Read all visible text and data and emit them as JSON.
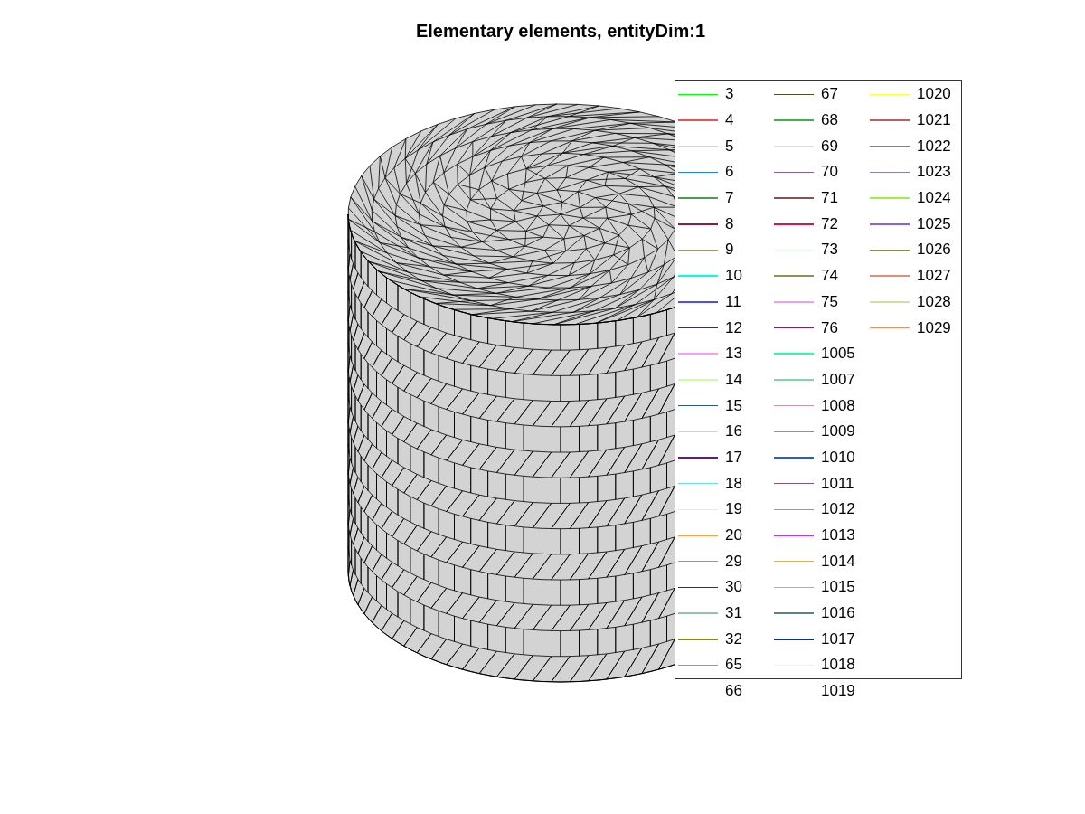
{
  "title": "Elementary elements, entityDim:1",
  "legend": {
    "entries": [
      {
        "label": "3",
        "color": "#00ff00"
      },
      {
        "label": "4",
        "color": "#f05050"
      },
      {
        "label": "5",
        "color": "#f5d76e"
      },
      {
        "label": "6",
        "color": "#1a80ff"
      },
      {
        "label": "7",
        "color": "#4d9e4d"
      },
      {
        "label": "8",
        "color": "#8b1a4a"
      },
      {
        "label": "9",
        "color": "#b89070"
      },
      {
        "label": "10",
        "color": "#00ffe0"
      },
      {
        "label": "11",
        "color": "#4d4dff"
      },
      {
        "label": "12",
        "color": "#3d2b5c"
      },
      {
        "label": "13",
        "color": "#ff99ff"
      },
      {
        "label": "14",
        "color": "#ccff99"
      },
      {
        "label": "15",
        "color": "#2b5c80"
      },
      {
        "label": "16",
        "color": "#ffc0c0"
      },
      {
        "label": "17",
        "color": "#6a0dad"
      },
      {
        "label": "18",
        "color": "#66e0f0"
      },
      {
        "label": "19",
        "color": "#ffe8b0"
      },
      {
        "label": "20",
        "color": "#ffa040"
      },
      {
        "label": "29",
        "color": "#b09090"
      },
      {
        "label": "30",
        "color": "#8b0a1a"
      },
      {
        "label": "31",
        "color": "#8fc4b0"
      },
      {
        "label": "32",
        "color": "#8b8b00"
      },
      {
        "label": "65",
        "color": "#ff60c0"
      },
      {
        "label": "66"
      },
      {
        "label": "67",
        "color": "#4a5028"
      },
      {
        "label": "68",
        "color": "#40b050"
      },
      {
        "label": "69",
        "color": "#f0f040"
      },
      {
        "label": "70",
        "color": "#8060b0"
      },
      {
        "label": "71",
        "color": "#8b5050"
      },
      {
        "label": "72",
        "color": "#e0104a"
      },
      {
        "label": "73",
        "color": "#e0ffe0"
      },
      {
        "label": "74",
        "color": "#909050"
      },
      {
        "label": "75",
        "color": "#f0a0f0"
      },
      {
        "label": "76",
        "color": "#80207a"
      },
      {
        "label": "1005",
        "color": "#20ffb0"
      },
      {
        "label": "1007",
        "color": "#80d8a0"
      },
      {
        "label": "1008",
        "color": "#d090b0"
      },
      {
        "label": "1009",
        "color": "#9090a0"
      },
      {
        "label": "1010",
        "color": "#1060ff"
      },
      {
        "label": "1011",
        "color": "#905070"
      },
      {
        "label": "1012",
        "color": "#ff7060"
      },
      {
        "label": "1013",
        "color": "#c030ff"
      },
      {
        "label": "1014",
        "color": "#e0b060"
      },
      {
        "label": "1015",
        "color": "#ff80c0"
      },
      {
        "label": "1016",
        "color": "#608080"
      },
      {
        "label": "1017",
        "color": "#0030a0"
      },
      {
        "label": "1018",
        "color": "#d0fff8"
      },
      {
        "label": "1019"
      },
      {
        "label": "1020",
        "color": "#ffff40"
      },
      {
        "label": "1021",
        "color": "#c06060"
      },
      {
        "label": "1022",
        "color": "#4090e0"
      },
      {
        "label": "1023",
        "color": "#9080b0"
      },
      {
        "label": "1024",
        "color": "#a0f040"
      },
      {
        "label": "1025",
        "color": "#9060e0"
      },
      {
        "label": "1026",
        "color": "#8b8b50"
      },
      {
        "label": "1027",
        "color": "#e09070"
      },
      {
        "label": "1028",
        "color": "#d0e0a0"
      },
      {
        "label": "1029",
        "color": "#f09060"
      }
    ]
  }
}
